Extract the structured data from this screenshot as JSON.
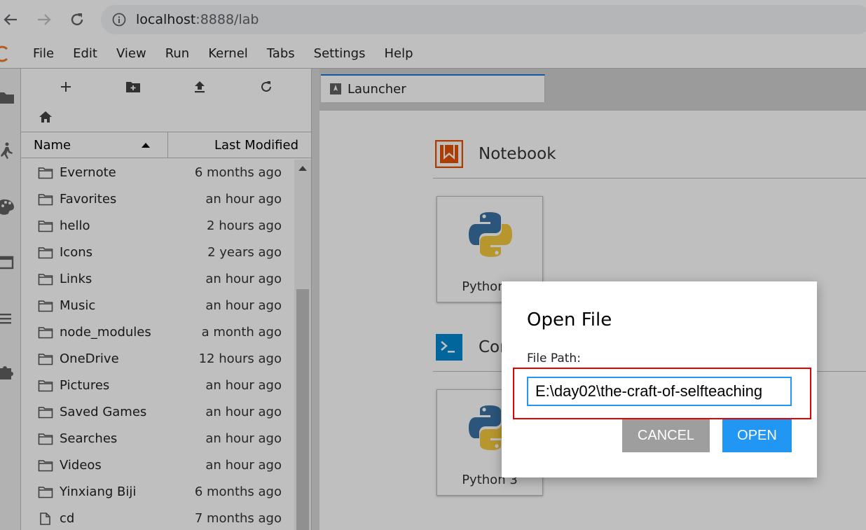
{
  "browser": {
    "url_host": "localhost",
    "url_rest": ":8888/lab"
  },
  "menubar": {
    "items": [
      "File",
      "Edit",
      "View",
      "Run",
      "Kernel",
      "Tabs",
      "Settings",
      "Help"
    ]
  },
  "file_browser": {
    "columns": {
      "name": "Name",
      "modified": "Last Modified"
    },
    "files": [
      {
        "name": "Evernote",
        "modified": "6 months ago",
        "type": "folder"
      },
      {
        "name": "Favorites",
        "modified": "an hour ago",
        "type": "folder"
      },
      {
        "name": "hello",
        "modified": "2 hours ago",
        "type": "folder"
      },
      {
        "name": "Icons",
        "modified": "2 years ago",
        "type": "folder"
      },
      {
        "name": "Links",
        "modified": "an hour ago",
        "type": "folder"
      },
      {
        "name": "Music",
        "modified": "an hour ago",
        "type": "folder"
      },
      {
        "name": "node_modules",
        "modified": "a month ago",
        "type": "folder"
      },
      {
        "name": "OneDrive",
        "modified": "12 hours ago",
        "type": "folder"
      },
      {
        "name": "Pictures",
        "modified": "an hour ago",
        "type": "folder"
      },
      {
        "name": "Saved Games",
        "modified": "an hour ago",
        "type": "folder"
      },
      {
        "name": "Searches",
        "modified": "an hour ago",
        "type": "folder"
      },
      {
        "name": "Videos",
        "modified": "an hour ago",
        "type": "folder"
      },
      {
        "name": "Yinxiang Biji",
        "modified": "6 months ago",
        "type": "folder"
      },
      {
        "name": "cd",
        "modified": "7 months ago",
        "type": "file"
      }
    ]
  },
  "tabs": [
    {
      "label": "Launcher"
    }
  ],
  "launcher": {
    "sections": [
      {
        "title": "Notebook",
        "card_label": "Python 3"
      },
      {
        "title": "Console",
        "card_label": "Python 3"
      }
    ]
  },
  "dialog": {
    "title": "Open File",
    "field_label": "File Path:",
    "field_value": "E:\\day02\\the-craft-of-selfteaching",
    "cancel_label": "CANCEL",
    "open_label": "OPEN"
  },
  "colors": {
    "accent": "#2196f3",
    "highlight_box": "#e60000",
    "notebook_icon": "#e65100",
    "console_icon": "#0288d1"
  }
}
